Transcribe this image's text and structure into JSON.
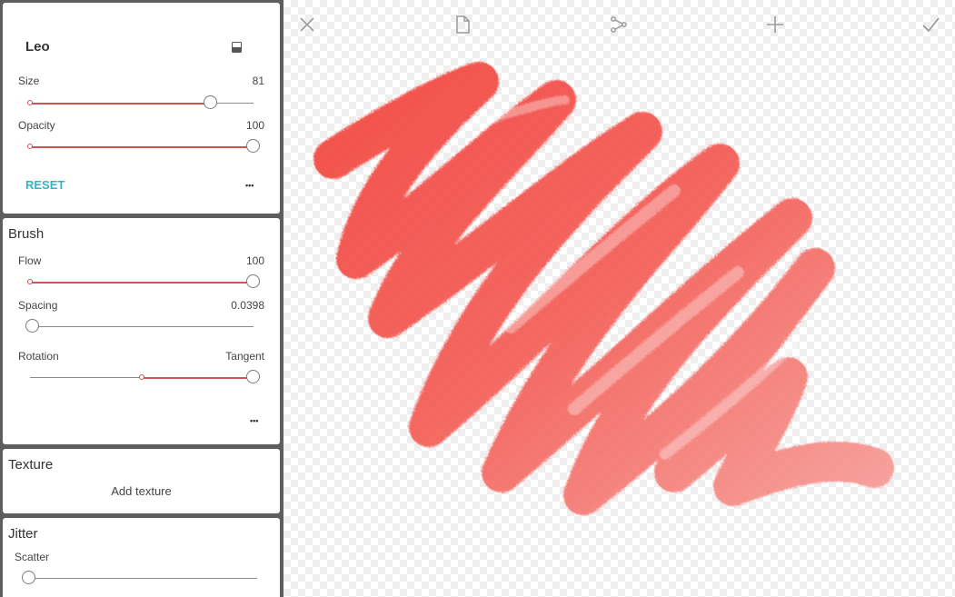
{
  "brush": {
    "name": "Leo",
    "size_label": "Size",
    "size_value": "81",
    "opacity_label": "Opacity",
    "opacity_value": "100",
    "reset_label": "RESET",
    "more_label": "•••"
  },
  "brush_section": {
    "title": "Brush",
    "flow_label": "Flow",
    "flow_value": "100",
    "spacing_label": "Spacing",
    "spacing_value": "0.0398",
    "rotation_label": "Rotation",
    "rotation_value": "Tangent",
    "more_label": "•••"
  },
  "texture_section": {
    "title": "Texture",
    "add_label": "Add texture"
  },
  "jitter_section": {
    "title": "Jitter",
    "scatter_label": "Scatter"
  },
  "toolbar": {
    "icons": [
      "close-icon",
      "document-icon",
      "share-icon",
      "add-icon",
      "check-icon"
    ]
  },
  "colors": {
    "accent": "#d2525a",
    "reset_text": "#33b5c5",
    "stroke_color": "#f2453f",
    "panel_background": "#5e5e5e"
  },
  "slider_levels": {
    "size": 0.81,
    "opacity": 1.0,
    "flow": 1.0,
    "spacing": 0.0,
    "rotation": 1.0,
    "scatter": 0.0
  }
}
